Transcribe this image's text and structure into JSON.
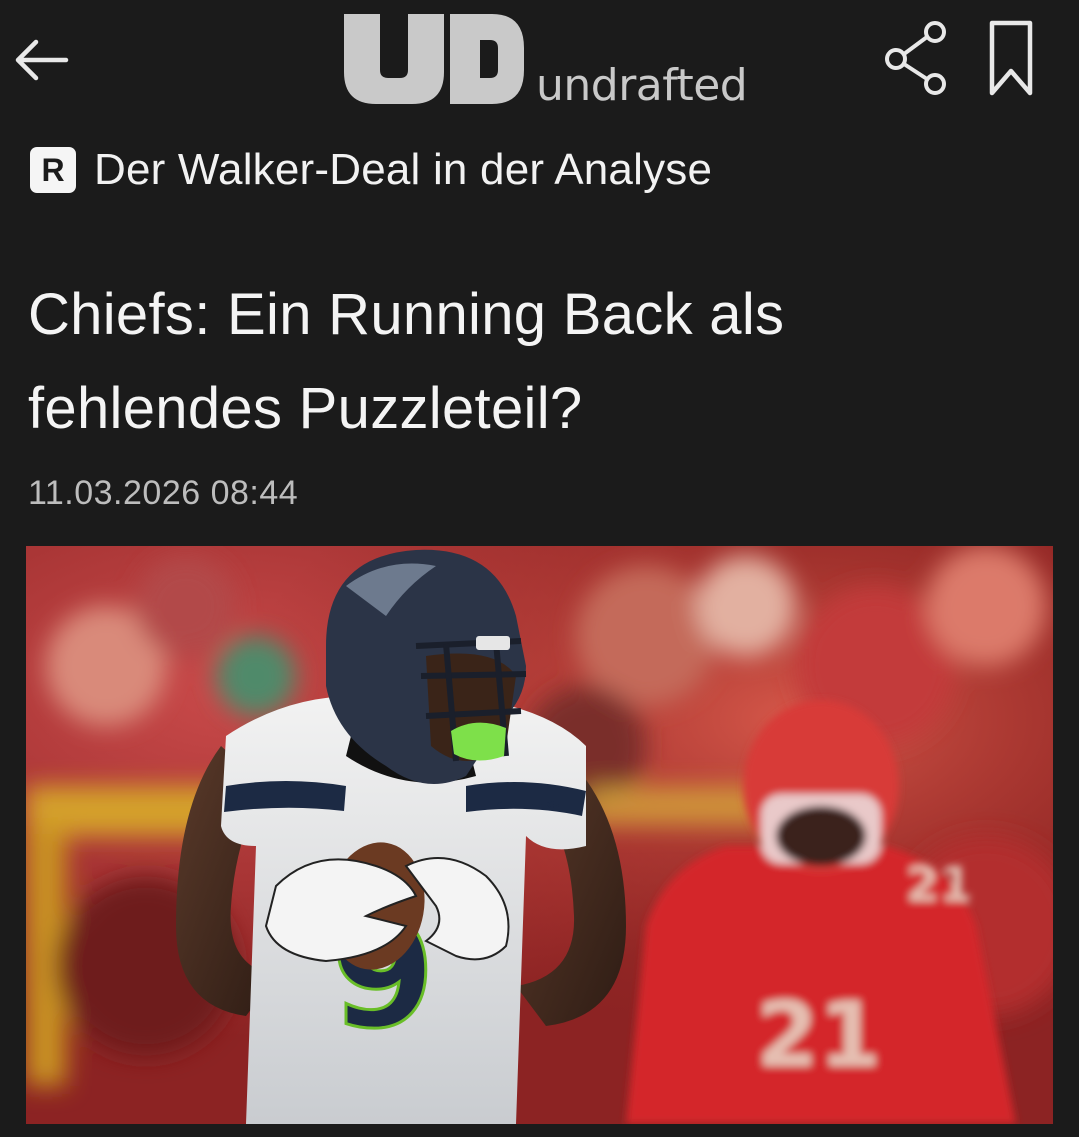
{
  "header": {
    "logo_wordmark": "undrafted",
    "logo_letters": "UD",
    "icons": {
      "back": "arrow-left-icon",
      "share": "share-icon",
      "bookmark": "bookmark-icon"
    }
  },
  "article": {
    "kicker_badge": "R",
    "kicker": "Der Walker-Deal in der Analyse",
    "headline_line1": "Chiefs: Ein Running Back als",
    "headline_line2": "fehlendes Puzzleteil?",
    "timestamp": "11.03.2026 08:44"
  },
  "hero_image": {
    "subject": "seahawks-running-back-with-football",
    "player_number": "9",
    "defender_number": "21",
    "colors": {
      "seahawks_navy": "#1c2a44",
      "seahawks_green": "#69be28",
      "chiefs_red": "#d4282c"
    }
  },
  "theme": {
    "background": "#1b1b1b",
    "text": "#f2f2f2",
    "muted": "#bdbdbd"
  }
}
